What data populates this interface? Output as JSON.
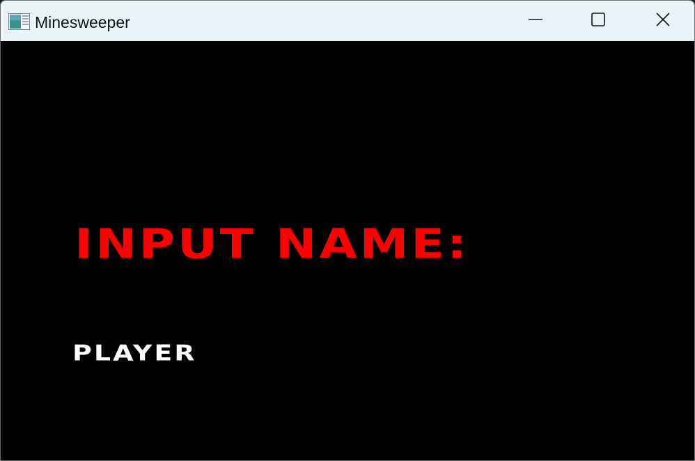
{
  "window": {
    "title": "Minesweeper",
    "icon": "app-window-icon",
    "controls": {
      "minimize_icon": "minimize-icon",
      "maximize_icon": "maximize-icon",
      "close_icon": "close-icon"
    }
  },
  "screen": {
    "prompt": "INPUT NAME:",
    "name_value": "PLAYER"
  },
  "colors": {
    "titlebar": "#eaf4f8",
    "background": "#000000",
    "prompt": "#ff0000",
    "name_text": "#ffffff"
  }
}
